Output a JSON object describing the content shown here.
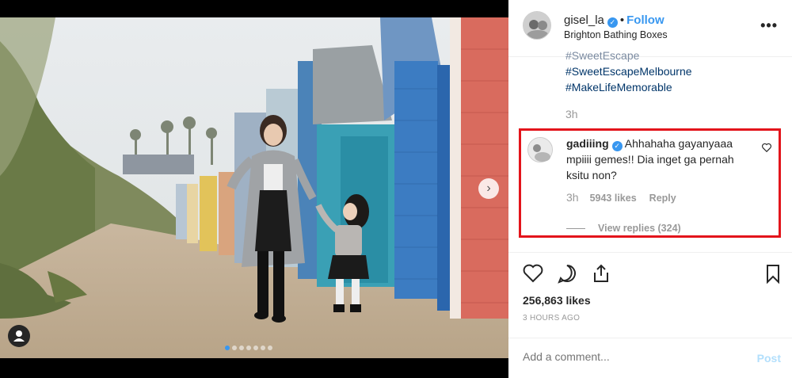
{
  "post": {
    "username": "gisel_la",
    "verified_mark": "✓",
    "separator": "•",
    "follow_label": "Follow",
    "location": "Brighton Bathing Boxes",
    "more_label": "•••"
  },
  "caption": {
    "cut_line": "#SweetEscape",
    "hashtags": [
      "#SweetEscapeMelbourne",
      "#MakeLifeMemorable"
    ],
    "age": "3h"
  },
  "comment": {
    "username": "gadiiing",
    "verified_mark": "✓",
    "text": "Ahhahaha gayanyaaa mpiiii gemes!! Dia inget ga pernah ksitu non?",
    "age": "3h",
    "likes": "5943 likes",
    "reply_label": "Reply",
    "view_replies": "View replies (324)"
  },
  "stats": {
    "likes": "256,863 likes",
    "time": "3 HOURS AGO"
  },
  "compose": {
    "placeholder": "Add a comment...",
    "post_label": "Post"
  },
  "gallery": {
    "next_label": "›",
    "slide_count": 7,
    "active_slide": 1
  },
  "colors": {
    "accent": "#3897f0",
    "highlight_border": "#e3141b",
    "hashtag": "#003569",
    "muted": "#999999"
  }
}
